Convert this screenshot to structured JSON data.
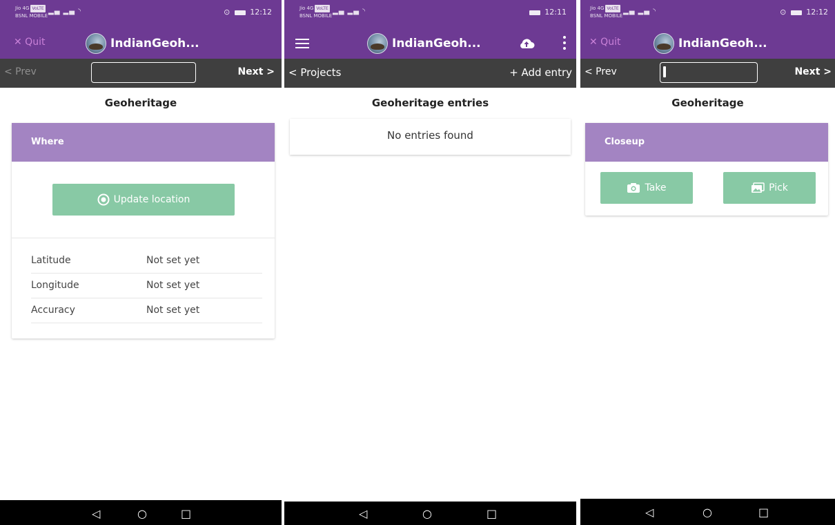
{
  "screens": [
    {
      "status": {
        "carrier_top": "Jio 4G",
        "carrier_badge": "VoLTE",
        "carrier_bottom": "BSNL MOBILE",
        "time": "12:12"
      },
      "appbar": {
        "quit": "✕ Quit",
        "title": "IndianGeoh..."
      },
      "nav": {
        "prev": "< Prev",
        "next": "Next >",
        "input_value": ""
      },
      "title": "Geoheritage",
      "card": {
        "header": "Where",
        "button": "Update location",
        "rows": [
          {
            "label": "Latitude",
            "value": "Not set yet"
          },
          {
            "label": "Longitude",
            "value": "Not set yet"
          },
          {
            "label": "Accuracy",
            "value": "Not set yet"
          }
        ]
      }
    },
    {
      "status": {
        "carrier_top": "Jio 4G",
        "carrier_badge": "VoLTE",
        "carrier_bottom": "BSNL MOBILE",
        "time": "12:11"
      },
      "appbar": {
        "title": "IndianGeoh..."
      },
      "nav": {
        "projects": "< Projects",
        "add_entry": "+ Add entry"
      },
      "title": "Geoheritage entries",
      "empty_text": "No entries found"
    },
    {
      "status": {
        "carrier_top": "Jio 4G",
        "carrier_badge": "VoLTE",
        "carrier_bottom": "BSNL MOBILE",
        "time": "12:12"
      },
      "appbar": {
        "quit": "✕ Quit",
        "title": "IndianGeoh..."
      },
      "nav": {
        "prev": "< Prev",
        "next": "Next >",
        "input_value": ""
      },
      "title": "Geoheritage",
      "card": {
        "header": "Closeup",
        "take": "Take",
        "pick": "Pick"
      }
    }
  ],
  "icons": {
    "back": "◁",
    "home": "○",
    "recent": "□",
    "location": "target-icon",
    "camera": "camera-icon",
    "gallery": "image-icon",
    "cloud": "cloud-upload-icon",
    "menu": "hamburger-menu-icon",
    "kebab": "more-vert-icon"
  },
  "colors": {
    "appbar": "#6d3a93",
    "navbar": "#3f3f3f",
    "card_header": "#a384c2",
    "button": "#88c9a5",
    "quit": "#c981d8"
  }
}
